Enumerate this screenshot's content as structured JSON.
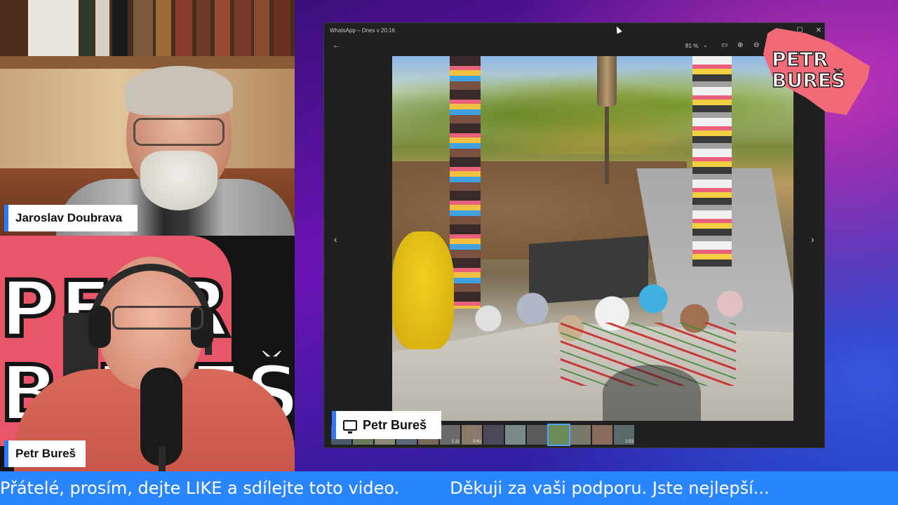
{
  "participants": [
    {
      "name": "Jaroslav Doubrava"
    },
    {
      "name": "Petr Bureš"
    }
  ],
  "backdrop_logo": {
    "line1": "PETR",
    "line2": "BUREŠ"
  },
  "window": {
    "title": "WhatsApp – Dnes v 20:16",
    "zoom": "81 %",
    "controls": {
      "minimize": "—",
      "maximize": "☐",
      "close": "✕"
    }
  },
  "filmstrip": [
    {
      "time": ""
    },
    {
      "time": ""
    },
    {
      "time": ""
    },
    {
      "time": ""
    },
    {
      "time": ""
    },
    {
      "time": "1:11"
    },
    {
      "time": "0:41"
    },
    {
      "time": ""
    },
    {
      "time": ""
    },
    {
      "time": ""
    },
    {
      "time": ""
    },
    {
      "time": ""
    },
    {
      "time": ""
    },
    {
      "time": "2:53"
    }
  ],
  "screen_share": {
    "label": "Petr Bureš"
  },
  "channel_logo": {
    "line1": "PETR",
    "line2": "BUREŠ"
  },
  "ticker": {
    "message1": "Přátelé, prosím, dejte LIKE a sdílejte toto video.",
    "message2": "Děkuji za vaši podporu. Jste nejlepší..."
  },
  "colors": {
    "accent": "#2a86ff",
    "logo_pink": "#f06a78",
    "window_bg": "#202020"
  },
  "icons": [
    "back-arrow-icon",
    "fit-icon",
    "zoom-in-icon",
    "zoom-out-icon",
    "monitor-icon",
    "chevron-left-icon",
    "chevron-right-icon"
  ]
}
